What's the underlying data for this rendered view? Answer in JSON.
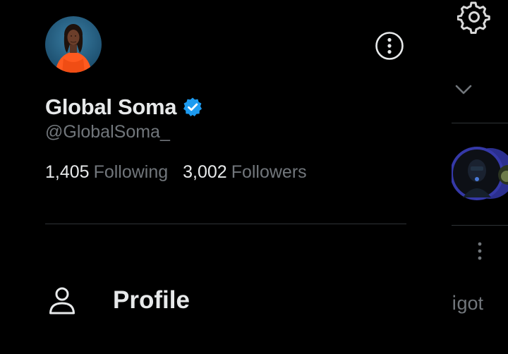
{
  "drawer": {
    "profile": {
      "display_name": "Global Soma",
      "handle": "@GlobalSoma_",
      "following_count": "1,405",
      "following_label": "Following",
      "followers_count": "3,002",
      "followers_label": "Followers",
      "verified": true
    },
    "menu": {
      "items": [
        {
          "label": "Profile",
          "icon": "person-icon"
        }
      ]
    }
  },
  "feed": {
    "partial_text": "got"
  },
  "colors": {
    "background": "#000000",
    "primary_text": "#e7e9ea",
    "secondary_text": "#71767b",
    "divider": "#2f3336",
    "verified_blue": "#1d9bf0"
  },
  "icons": {
    "settings": "gear-icon",
    "chevron": "chevron-down-icon",
    "more": "more-vertical-icon",
    "verified": "verified-badge-icon",
    "profile": "person-icon"
  }
}
